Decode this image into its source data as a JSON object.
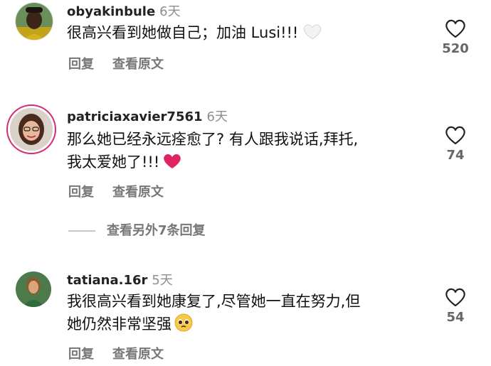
{
  "comments": [
    {
      "username": "obyakinbule",
      "time": "6天",
      "text_lines": [
        "很高兴看到她做自己；加油 Lusi!!!"
      ],
      "emoji": "white-heart",
      "like_count": "520",
      "actions": {
        "reply": "回复",
        "view_original": "查看原文"
      }
    },
    {
      "username": "patriciaxavier7561",
      "time": "6天",
      "text_lines": [
        "那么她已经永远痊愈了? 有人跟我说话,拜托,",
        "我太爱她了!!!"
      ],
      "emoji": "red-heart",
      "like_count": "74",
      "actions": {
        "reply": "回复",
        "view_original": "查看原文"
      }
    },
    {
      "username": "tatiana.16r",
      "time": "5天",
      "text_lines": [
        "我很高兴看到她康复了,尽管她一直在努力,但",
        "她仍然非常坚强"
      ],
      "emoji": "pleading-face",
      "like_count": "54",
      "actions": {
        "reply": "回复",
        "view_original": "查看原文"
      }
    }
  ],
  "more_replies": "查看另外7条回复",
  "colors": {
    "secondary_text": "#8e8e8e",
    "red_heart": "#e0245e"
  }
}
